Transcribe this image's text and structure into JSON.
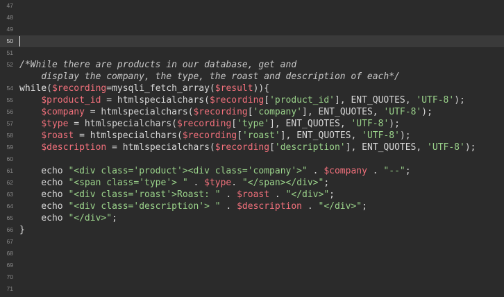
{
  "editor": {
    "colors": {
      "background": "#2b2b2b",
      "active_line": "#3a3a3a",
      "text": "#d6d6d6",
      "variable": "#f1707b",
      "string": "#9ad28a",
      "line_number": "#8a8a8a"
    },
    "active_line_number": "50",
    "lines": [
      {
        "n": "47",
        "tokens": []
      },
      {
        "n": "48",
        "tokens": []
      },
      {
        "n": "49",
        "tokens": []
      },
      {
        "n": "50",
        "tokens": [],
        "active": true
      },
      {
        "n": "51",
        "tokens": []
      },
      {
        "n": "52",
        "tokens": [
          {
            "t": "comment",
            "v": "/*While there are products in our database, get and"
          }
        ]
      },
      {
        "n": "",
        "tokens": [
          {
            "t": "comment",
            "v": "    display the company, the type, the roast and description of each*/"
          }
        ]
      },
      {
        "n": "54",
        "tokens": [
          {
            "t": "keyword",
            "v": "while"
          },
          {
            "t": "default",
            "v": "("
          },
          {
            "t": "variable",
            "v": "$recording"
          },
          {
            "t": "default",
            "v": "=mysqli_fetch_array("
          },
          {
            "t": "variable",
            "v": "$result"
          },
          {
            "t": "default",
            "v": ")){"
          }
        ]
      },
      {
        "n": "55",
        "tokens": [
          {
            "t": "default",
            "v": "    "
          },
          {
            "t": "variable",
            "v": "$product_id"
          },
          {
            "t": "default",
            "v": " = htmlspecialchars("
          },
          {
            "t": "variable",
            "v": "$recording"
          },
          {
            "t": "default",
            "v": "["
          },
          {
            "t": "string",
            "v": "'product_id'"
          },
          {
            "t": "default",
            "v": "], ENT_QUOTES, "
          },
          {
            "t": "string",
            "v": "'UTF-8'"
          },
          {
            "t": "default",
            "v": ");"
          }
        ]
      },
      {
        "n": "56",
        "tokens": [
          {
            "t": "default",
            "v": "    "
          },
          {
            "t": "variable",
            "v": "$company"
          },
          {
            "t": "default",
            "v": " = htmlspecialchars("
          },
          {
            "t": "variable",
            "v": "$recording"
          },
          {
            "t": "default",
            "v": "["
          },
          {
            "t": "string",
            "v": "'company'"
          },
          {
            "t": "default",
            "v": "], ENT_QUOTES, "
          },
          {
            "t": "string",
            "v": "'UTF-8'"
          },
          {
            "t": "default",
            "v": ");"
          }
        ]
      },
      {
        "n": "57",
        "tokens": [
          {
            "t": "default",
            "v": "    "
          },
          {
            "t": "variable",
            "v": "$type"
          },
          {
            "t": "default",
            "v": " = htmlspecialchars("
          },
          {
            "t": "variable",
            "v": "$recording"
          },
          {
            "t": "default",
            "v": "["
          },
          {
            "t": "string",
            "v": "'type'"
          },
          {
            "t": "default",
            "v": "], ENT_QUOTES, "
          },
          {
            "t": "string",
            "v": "'UTF-8'"
          },
          {
            "t": "default",
            "v": ");"
          }
        ]
      },
      {
        "n": "58",
        "tokens": [
          {
            "t": "default",
            "v": "    "
          },
          {
            "t": "variable",
            "v": "$roast"
          },
          {
            "t": "default",
            "v": " = htmlspecialchars("
          },
          {
            "t": "variable",
            "v": "$recording"
          },
          {
            "t": "default",
            "v": "["
          },
          {
            "t": "string",
            "v": "'roast'"
          },
          {
            "t": "default",
            "v": "], ENT_QUOTES, "
          },
          {
            "t": "string",
            "v": "'UTF-8'"
          },
          {
            "t": "default",
            "v": ");"
          }
        ]
      },
      {
        "n": "59",
        "tokens": [
          {
            "t": "default",
            "v": "    "
          },
          {
            "t": "variable",
            "v": "$description"
          },
          {
            "t": "default",
            "v": " = htmlspecialchars("
          },
          {
            "t": "variable",
            "v": "$recording"
          },
          {
            "t": "default",
            "v": "["
          },
          {
            "t": "string",
            "v": "'description'"
          },
          {
            "t": "default",
            "v": "], ENT_QUOTES, "
          },
          {
            "t": "string",
            "v": "'UTF-8'"
          },
          {
            "t": "default",
            "v": ");"
          }
        ]
      },
      {
        "n": "60",
        "tokens": []
      },
      {
        "n": "61",
        "tokens": [
          {
            "t": "default",
            "v": "    echo "
          },
          {
            "t": "string",
            "v": "\"<div class='product'><div class='company'>\""
          },
          {
            "t": "default",
            "v": " . "
          },
          {
            "t": "variable",
            "v": "$company"
          },
          {
            "t": "default",
            "v": " . "
          },
          {
            "t": "string",
            "v": "\"--\""
          },
          {
            "t": "default",
            "v": ";"
          }
        ]
      },
      {
        "n": "62",
        "tokens": [
          {
            "t": "default",
            "v": "    echo "
          },
          {
            "t": "string",
            "v": "\"<span class='type'> \""
          },
          {
            "t": "default",
            "v": " . "
          },
          {
            "t": "variable",
            "v": "$type"
          },
          {
            "t": "default",
            "v": ". "
          },
          {
            "t": "string",
            "v": "\"</span></div>\""
          },
          {
            "t": "default",
            "v": ";"
          }
        ]
      },
      {
        "n": "63",
        "tokens": [
          {
            "t": "default",
            "v": "    echo "
          },
          {
            "t": "string",
            "v": "\"<div class='roast'>Roast: \""
          },
          {
            "t": "default",
            "v": " . "
          },
          {
            "t": "variable",
            "v": "$roast"
          },
          {
            "t": "default",
            "v": " . "
          },
          {
            "t": "string",
            "v": "\"</div>\""
          },
          {
            "t": "default",
            "v": ";"
          }
        ]
      },
      {
        "n": "64",
        "tokens": [
          {
            "t": "default",
            "v": "    echo "
          },
          {
            "t": "string",
            "v": "\"<div class='description'> \""
          },
          {
            "t": "default",
            "v": " . "
          },
          {
            "t": "variable",
            "v": "$description"
          },
          {
            "t": "default",
            "v": " . "
          },
          {
            "t": "string",
            "v": "\"</div>\""
          },
          {
            "t": "default",
            "v": ";"
          }
        ]
      },
      {
        "n": "65",
        "tokens": [
          {
            "t": "default",
            "v": "    echo "
          },
          {
            "t": "string",
            "v": "\"</div>\""
          },
          {
            "t": "default",
            "v": ";"
          }
        ]
      },
      {
        "n": "66",
        "tokens": [
          {
            "t": "default",
            "v": "}"
          }
        ]
      },
      {
        "n": "67",
        "tokens": []
      },
      {
        "n": "68",
        "tokens": []
      },
      {
        "n": "69",
        "tokens": []
      },
      {
        "n": "70",
        "tokens": []
      },
      {
        "n": "71",
        "tokens": []
      }
    ]
  }
}
